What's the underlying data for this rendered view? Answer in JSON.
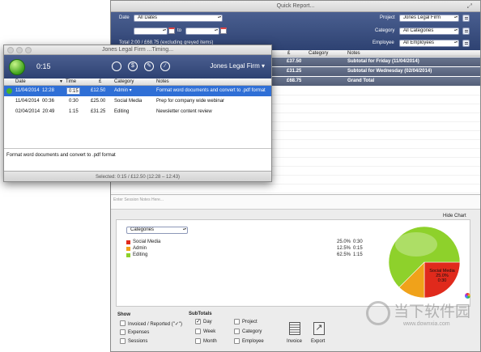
{
  "report": {
    "title": "Quick Report...",
    "date_label": "Date",
    "date_value": "All Dates",
    "to_label": "to",
    "project_label": "Project",
    "project_value": "Jones Legal Firm",
    "category_label": "Category",
    "category_value": "All Categories",
    "employee_label": "Employee",
    "employee_value": "All Employees",
    "total_text": "Total  2:00 / £68.75 (excluding greyed items)",
    "columns": {
      "amount": "£",
      "category": "Category",
      "notes": "Notes"
    },
    "subtotals": [
      {
        "amount": "£37.50",
        "notes": "Subtotal for Friday (11/04/2014)"
      },
      {
        "amount": "£31.25",
        "notes": "Subtotal for Wednesday (02/04/2014)"
      },
      {
        "amount": "£68.75",
        "notes": "Grand Total"
      }
    ],
    "session_notes_placeholder": "Enter Session Notes Here...",
    "hide_chart": "Hide Chart",
    "chart_dropdown": "Categories",
    "show_label": "Show",
    "show_options": [
      "Invoiced / Reported (\"✓\")",
      "Expenses",
      "Sessions"
    ],
    "subtotals_label": "SubTotals",
    "subtotal_options": [
      "Day",
      "Week",
      "Month",
      "Project",
      "Category",
      "Employee"
    ],
    "invoice_label": "Invoice",
    "export_label": "Export"
  },
  "chart_data": {
    "type": "pie",
    "categories": [
      "Social Media",
      "Admin",
      "Editing"
    ],
    "values": [
      25.0,
      12.5,
      62.5
    ],
    "durations": [
      "0:30",
      "0:15",
      "1:15"
    ],
    "percent_labels": [
      "25.0%",
      "12.5%",
      "62.5%"
    ],
    "colors": [
      "#e02a1c",
      "#f0a21a",
      "#8ed12b"
    ],
    "slice_label": "Social Media",
    "slice_percent": "25.0%",
    "slice_duration": "0:30",
    "legend_position": "left"
  },
  "timing": {
    "title": "Jones Legal Firm ...Timing...",
    "elapsed": "0:15",
    "project": "Jones Legal Firm",
    "columns": {
      "date": "Date",
      "time": "Time",
      "amount": "£",
      "category": "Category",
      "notes": "Notes"
    },
    "rows": [
      {
        "date": "11/04/2014",
        "time": "12:28",
        "duration": "0:15",
        "amount": "£12.50",
        "category": "Admin",
        "notes": "Format word documents and convert to .pdf format"
      },
      {
        "date": "11/04/2014",
        "time": "00:36",
        "duration": "0:30",
        "amount": "£25.00",
        "category": "Social Media",
        "notes": "Prep for company wide webinar"
      },
      {
        "date": "02/04/2014",
        "time": "20:49",
        "duration": "1:15",
        "amount": "£31.25",
        "category": "Editing",
        "notes": "Newsletter content review"
      }
    ],
    "notes_text": "Format word documents and convert to .pdf format",
    "status": "Selected: 0:15 / £12.50 (12:28 – 12:43)"
  },
  "watermark": {
    "cn": "当下软件园",
    "url": "www.downxia.com"
  }
}
